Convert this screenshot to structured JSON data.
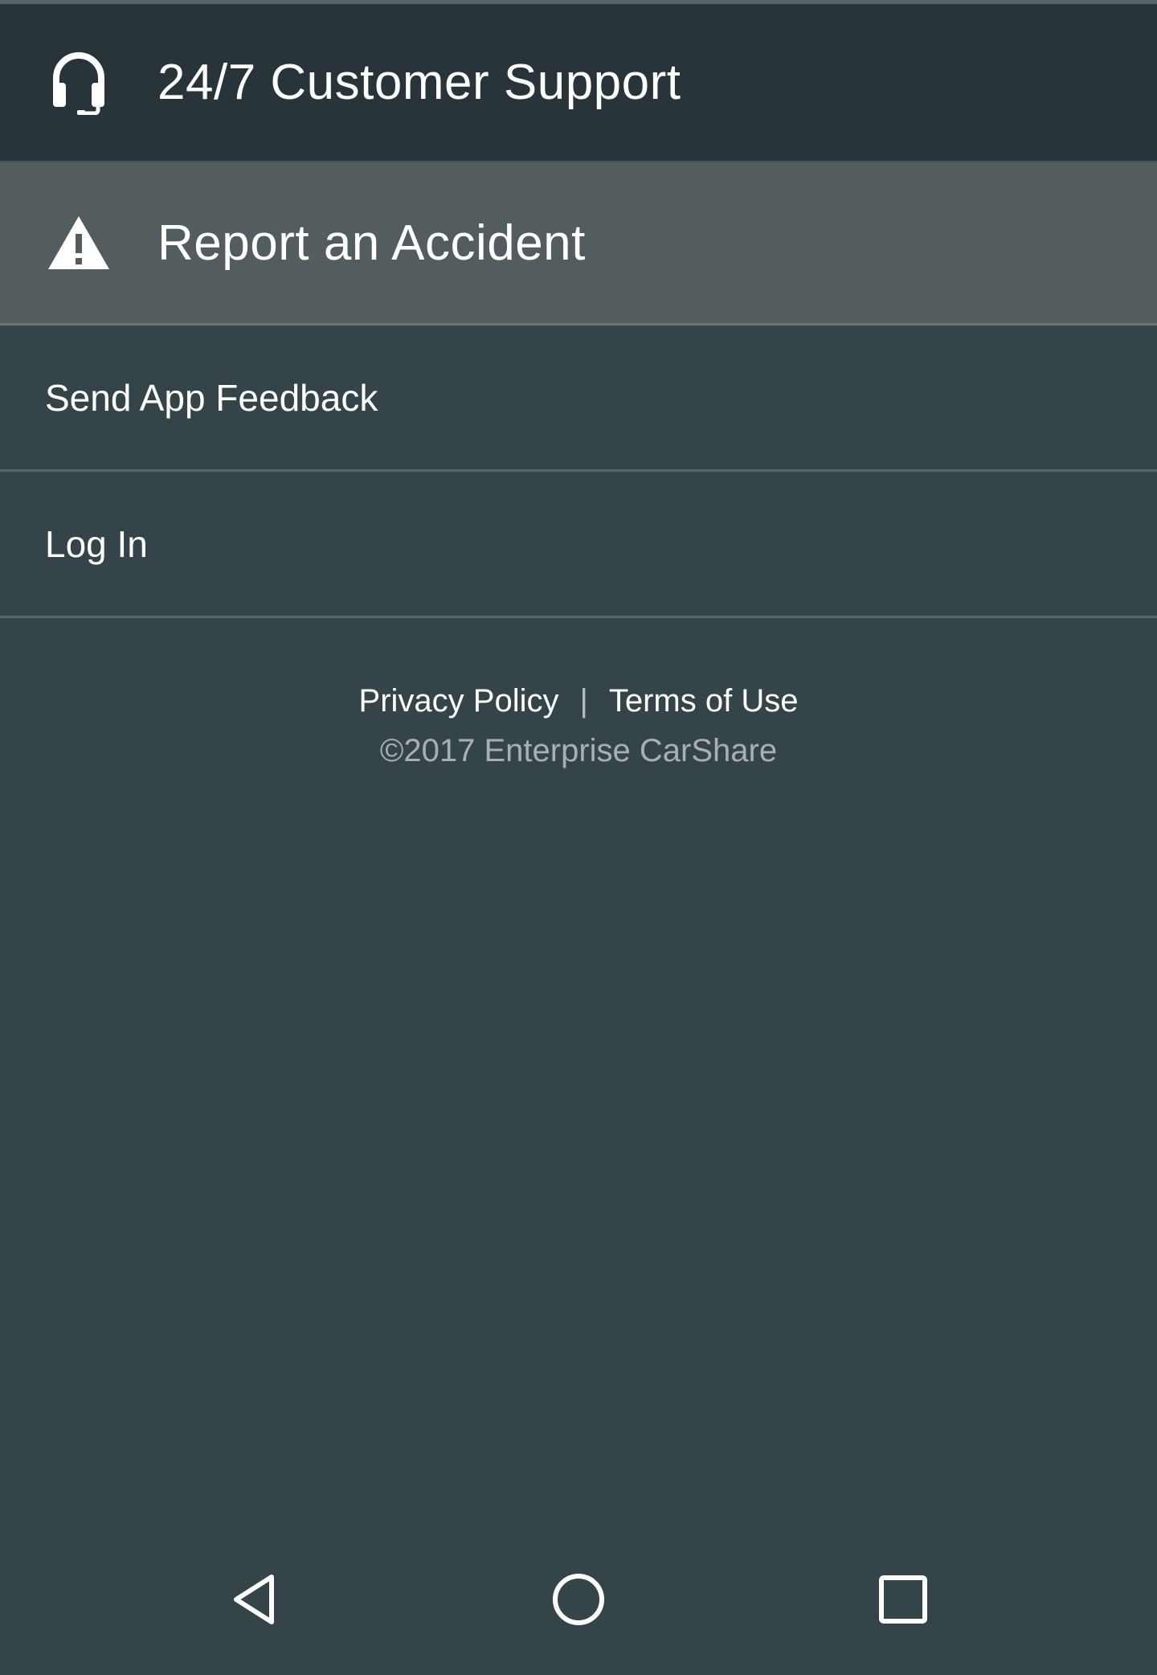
{
  "menu": {
    "support": {
      "label": "24/7 Customer Support",
      "icon": "headset-icon"
    },
    "accident": {
      "label": "Report an Accident",
      "icon": "warning-icon"
    },
    "feedback": {
      "label": "Send App Feedback"
    },
    "login": {
      "label": "Log In"
    }
  },
  "footer": {
    "privacy": "Privacy Policy",
    "separator": "|",
    "terms": "Terms of Use",
    "copyright": "©2017 Enterprise CarShare"
  },
  "navbar": {
    "back_icon": "back-triangle-icon",
    "home_icon": "home-circle-icon",
    "recents_icon": "recents-square-icon"
  },
  "colors": {
    "background": "#354449",
    "support_row": "#283439",
    "accident_row_selected": "#535c5f",
    "text": "#ffffff",
    "copyright_text": "#a9b0b3"
  }
}
